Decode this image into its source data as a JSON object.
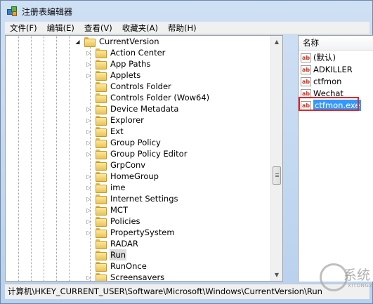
{
  "window": {
    "title": "注册表编辑器"
  },
  "menu": [
    "文件(F)",
    "编辑(E)",
    "查看(V)",
    "收藏夹(A)",
    "帮助(H)"
  ],
  "tree": {
    "parent": "CurrentVersion",
    "items": [
      {
        "label": "Action Center",
        "expandable": true
      },
      {
        "label": "App Paths",
        "expandable": true
      },
      {
        "label": "Applets",
        "expandable": true
      },
      {
        "label": "Controls Folder",
        "expandable": false
      },
      {
        "label": "Controls Folder (Wow64)",
        "expandable": false
      },
      {
        "label": "Device Metadata",
        "expandable": true
      },
      {
        "label": "Explorer",
        "expandable": true
      },
      {
        "label": "Ext",
        "expandable": true
      },
      {
        "label": "Group Policy",
        "expandable": true
      },
      {
        "label": "Group Policy Editor",
        "expandable": true
      },
      {
        "label": "GrpConv",
        "expandable": false
      },
      {
        "label": "HomeGroup",
        "expandable": true
      },
      {
        "label": "ime",
        "expandable": true
      },
      {
        "label": "Internet Settings",
        "expandable": true
      },
      {
        "label": "MCT",
        "expandable": true
      },
      {
        "label": "Policies",
        "expandable": true
      },
      {
        "label": "PropertySystem",
        "expandable": true
      },
      {
        "label": "RADAR",
        "expandable": false
      },
      {
        "label": "Run",
        "expandable": false,
        "selected": true
      },
      {
        "label": "RunOnce",
        "expandable": false
      },
      {
        "label": "Screensavers",
        "expandable": true
      }
    ]
  },
  "list": {
    "header": "名称",
    "items": [
      {
        "label": "(默认)",
        "icon": "ab"
      },
      {
        "label": "ADKILLER",
        "icon": "ab"
      },
      {
        "label": "ctfmon",
        "icon": "ab"
      },
      {
        "label": "Wechat",
        "icon": "ab"
      },
      {
        "label": "ctfmon.exe",
        "icon": "ab",
        "selected": true
      }
    ]
  },
  "statusbar": {
    "path": "计算机\\HKEY_CURRENT_USER\\Software\\Microsoft\\Windows\\CurrentVersion\\Run"
  },
  "watermark": {
    "text": "系统",
    "sub": "XITONGZHIJIA"
  },
  "colors": {
    "selection": "#3399ff",
    "highlight_box": "#e3262a"
  }
}
